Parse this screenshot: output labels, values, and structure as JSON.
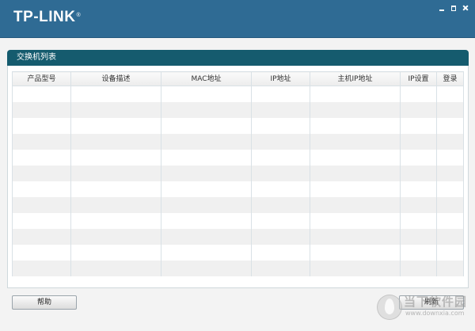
{
  "app": {
    "logo": "TP-LINK",
    "logo_mark": "®"
  },
  "window_controls": {
    "minimize_icon": "minimize-icon",
    "maximize_icon": "maximize-icon",
    "close_icon": "close-icon"
  },
  "panel": {
    "title": "交换机列表"
  },
  "table": {
    "columns": [
      "产品型号",
      "设备描述",
      "MAC地址",
      "IP地址",
      "主机IP地址",
      "IP设置",
      "登录"
    ],
    "rows": [
      [
        "",
        "",
        "",
        "",
        "",
        "",
        ""
      ],
      [
        "",
        "",
        "",
        "",
        "",
        "",
        ""
      ],
      [
        "",
        "",
        "",
        "",
        "",
        "",
        ""
      ],
      [
        "",
        "",
        "",
        "",
        "",
        "",
        ""
      ],
      [
        "",
        "",
        "",
        "",
        "",
        "",
        ""
      ],
      [
        "",
        "",
        "",
        "",
        "",
        "",
        ""
      ],
      [
        "",
        "",
        "",
        "",
        "",
        "",
        ""
      ],
      [
        "",
        "",
        "",
        "",
        "",
        "",
        ""
      ],
      [
        "",
        "",
        "",
        "",
        "",
        "",
        ""
      ],
      [
        "",
        "",
        "",
        "",
        "",
        "",
        ""
      ],
      [
        "",
        "",
        "",
        "",
        "",
        "",
        ""
      ],
      [
        "",
        "",
        "",
        "",
        "",
        "",
        ""
      ]
    ]
  },
  "buttons": {
    "help": "帮助",
    "refresh": "刷新"
  },
  "watermark": {
    "line1": "当下软件园",
    "line2": "www.downxia.com"
  },
  "colors": {
    "titlebar": "#2f6b94",
    "panel_header": "#155b6e"
  }
}
